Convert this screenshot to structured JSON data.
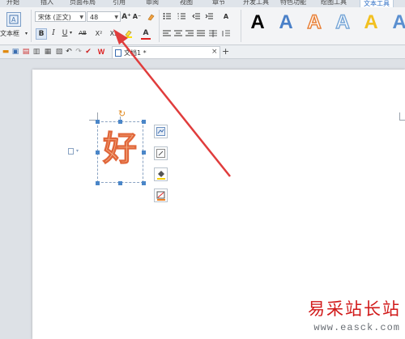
{
  "ribbon_tabs": [
    {
      "label": "开始",
      "x_hint": "a"
    },
    {
      "label": "插入"
    },
    {
      "label": "页面布局"
    },
    {
      "label": "引用"
    },
    {
      "label": "审阅"
    },
    {
      "label": "视图"
    },
    {
      "label": "章节"
    },
    {
      "label": "开发工具"
    },
    {
      "label": "特色功能"
    },
    {
      "label": "绘图工具"
    },
    {
      "label": "文本工具",
      "active": true
    }
  ],
  "ribbon": {
    "textbox_label": "文本框",
    "font_name": "宋体 (正文)",
    "font_size": "48",
    "bold": "B",
    "italic": "I",
    "underline": "U",
    "strikethrough": "AB",
    "superscript": "X²",
    "subscript": "X₂",
    "font_color": "A",
    "grow_font": "A⁺",
    "shrink_font": "A⁻",
    "style_samples": [
      "A",
      "A",
      "A",
      "A",
      "A",
      "A"
    ]
  },
  "quickbar": {
    "doc_tab_label": "文档1 *",
    "close_glyph": "×",
    "add_glyph": "+"
  },
  "document": {
    "textbox_character": "好"
  },
  "watermark": {
    "site_name": "易采站长站",
    "url": "www.easck.com"
  },
  "colors": {
    "accent": "#2b6cc4",
    "arrow": "#e03c3c",
    "glyph_fill": "#f6b38b",
    "glyph_stroke": "#e0663a",
    "watermark": "#d11a1a"
  }
}
